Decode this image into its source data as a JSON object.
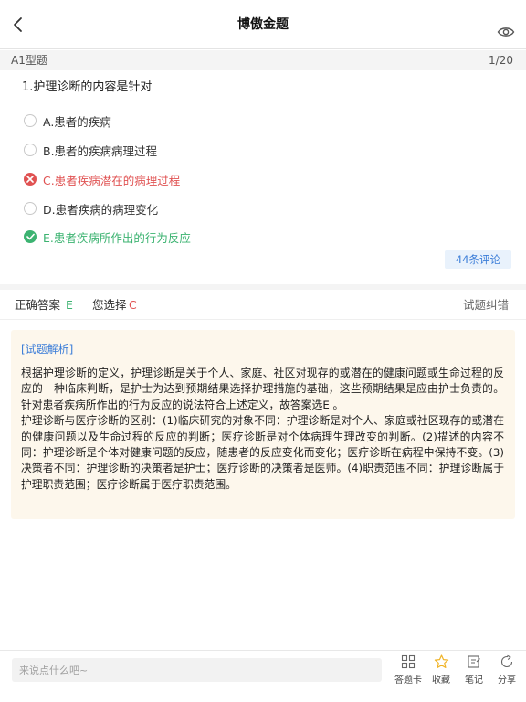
{
  "nav": {
    "title": "博傲金题"
  },
  "qbar": {
    "type": "A1型题",
    "progress": "1/20"
  },
  "question": {
    "text": "1.护理诊断的内容是针对"
  },
  "options": [
    {
      "label": "A.患者的疾病",
      "state": "none"
    },
    {
      "label": "B.患者的疾病病理过程",
      "state": "none"
    },
    {
      "label": "C.患者疾病潜在的病理过程",
      "state": "wrong"
    },
    {
      "label": "D.患者疾病的病理变化",
      "state": "none"
    },
    {
      "label": "E.患者疾病所作出的行为反应",
      "state": "right"
    }
  ],
  "comments": {
    "label": "44条评论"
  },
  "answer": {
    "correct_label": "正确答案",
    "correct_value": "E",
    "chosen_label": "您选择",
    "chosen_value": "C",
    "report_label": "试题纠错"
  },
  "analysis": {
    "heading": "[试题解析]",
    "para1": "根据护理诊断的定义，护理诊断是关于个人、家庭、社区对现存的或潜在的健康问题或生命过程的反应的一种临床判断，是护士为达到预期结果选择护理措施的基础，这些预期结果是应由护士负责的。针对患者疾病所作出的行为反应的说法符合上述定义，故答案选E 。",
    "para2": "护理诊断与医疗诊断的区别：(1)临床研究的对象不同：护理诊断是对个人、家庭或社区现存的或潜在的健康问题以及生命过程的反应的判断；医疗诊断是对个体病理生理改变的判断。(2)描述的内容不同：护理诊断是个体对健康问题的反应，随患者的反应变化而变化；医疗诊断在病程中保持不变。(3)决策者不同：护理诊断的决策者是护士；医疗诊断的决策者是医师。(4)职责范围不同：护理诊断属于护理职责范围；医疗诊断属于医疗职责范围。"
  },
  "bottom": {
    "placeholder": "来说点什么吧~",
    "tools": {
      "card": "答题卡",
      "favorite": "收藏",
      "note": "笔记",
      "share": "分享"
    }
  },
  "colors": {
    "correct": "#3cb371",
    "wrong": "#e05252",
    "link": "#3b7dd8",
    "analysis_bg": "#fdf7ec"
  }
}
